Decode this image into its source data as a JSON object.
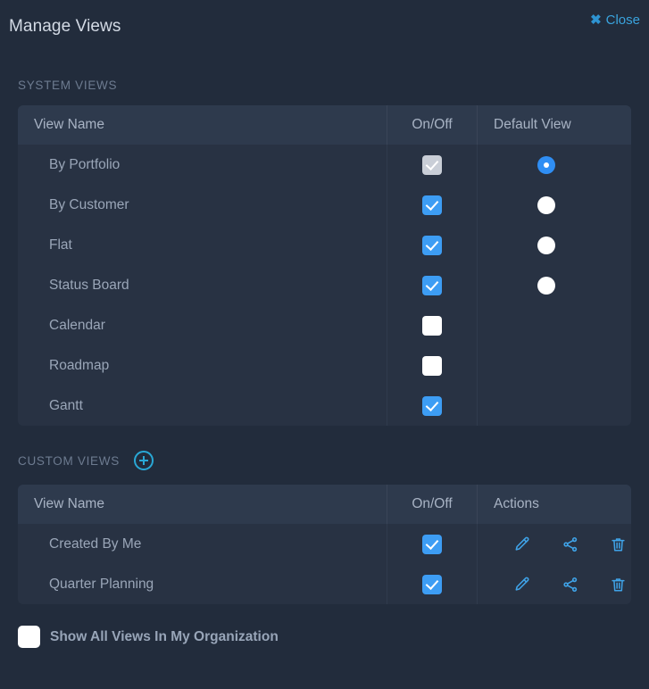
{
  "dialog": {
    "title": "Manage Views",
    "close_label": "Close",
    "close_icon": "close-x-icon"
  },
  "system_section": {
    "label": "SYSTEM VIEWS",
    "columns": [
      "View Name",
      "On/Off",
      "Default View"
    ],
    "rows": [
      {
        "name": "By Portfolio",
        "on": true,
        "on_disabled": true,
        "has_default": true,
        "default_selected": true
      },
      {
        "name": "By Customer",
        "on": true,
        "on_disabled": false,
        "has_default": true,
        "default_selected": false
      },
      {
        "name": "Flat",
        "on": true,
        "on_disabled": false,
        "has_default": true,
        "default_selected": false
      },
      {
        "name": "Status Board",
        "on": true,
        "on_disabled": false,
        "has_default": true,
        "default_selected": false
      },
      {
        "name": "Calendar",
        "on": false,
        "on_disabled": false,
        "has_default": false,
        "default_selected": false
      },
      {
        "name": "Roadmap",
        "on": false,
        "on_disabled": false,
        "has_default": false,
        "default_selected": false
      },
      {
        "name": "Gantt",
        "on": true,
        "on_disabled": false,
        "has_default": false,
        "default_selected": false
      }
    ]
  },
  "custom_section": {
    "label": "CUSTOM VIEWS",
    "add_icon": "plus-circle-icon",
    "columns": [
      "View Name",
      "On/Off",
      "Actions"
    ],
    "action_icons": [
      "edit-pencil-icon",
      "share-icon",
      "trash-icon"
    ],
    "rows": [
      {
        "name": "Created By Me",
        "on": true
      },
      {
        "name": "Quarter Planning",
        "on": true
      }
    ]
  },
  "footer": {
    "show_all_label": "Show All Views In My Organization",
    "show_all_checked": false
  },
  "colors": {
    "background": "#222c3c",
    "table_body": "#283243",
    "table_header": "#2e3a4d",
    "accent_blue": "#3d9df4",
    "link_blue": "#3aa3dd",
    "icon_cyan": "#29a8d6",
    "text_muted": "#6d7b90",
    "text_primary": "#d3dae5"
  }
}
